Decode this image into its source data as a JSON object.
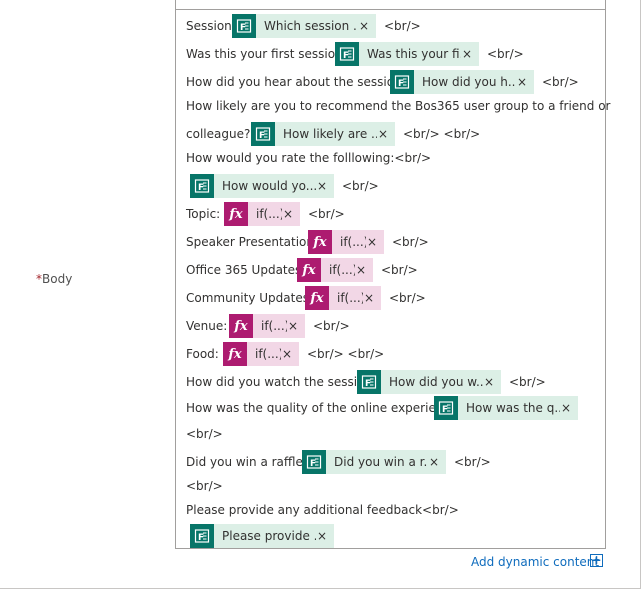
{
  "field": {
    "required_mark": "*",
    "label": "Body"
  },
  "rows": [
    {
      "prefix": "Session:",
      "token": {
        "kind": "forms",
        "label": "Which session ..."
      },
      "suffix": "<br/>"
    },
    {
      "prefix": "Was this your first session?",
      "token": {
        "kind": "forms",
        "label": "Was this your fi..."
      },
      "suffix": "<br/>"
    },
    {
      "prefix": "How did you hear about the session?",
      "token": {
        "kind": "forms",
        "label": "How did you h..."
      },
      "suffix": "<br/>"
    },
    {
      "text": "How likely are you to recommend the Bos365 user group to a friend or"
    },
    {
      "prefix": "colleague?",
      "token": {
        "kind": "forms",
        "label": "How likely are ..."
      },
      "suffix": "<br/> <br/>"
    },
    {
      "text": "How would you rate the folllowing:<br/>"
    },
    {
      "prefix": "",
      "token": {
        "kind": "forms",
        "label": "How would yo..."
      },
      "suffix": "<br/>"
    },
    {
      "prefix": "Topic:",
      "token": {
        "kind": "expression",
        "label": "if(...)"
      },
      "suffix": "<br/>"
    },
    {
      "prefix": "Speaker Presentation:",
      "token": {
        "kind": "expression",
        "label": "if(...)"
      },
      "suffix": "<br/>"
    },
    {
      "prefix": "Office 365 Updates:",
      "token": {
        "kind": "expression",
        "label": "if(...)"
      },
      "suffix": "<br/>"
    },
    {
      "prefix": "Community Updates:",
      "token": {
        "kind": "expression",
        "label": "if(...)"
      },
      "suffix": "<br/>"
    },
    {
      "prefix": "Venue:",
      "token": {
        "kind": "expression",
        "label": "if(...)"
      },
      "suffix": "<br/>"
    },
    {
      "prefix": "Food:",
      "token": {
        "kind": "expression",
        "label": "if(...)"
      },
      "suffix": "<br/> <br/>"
    },
    {
      "prefix": "How did you watch the session:",
      "token": {
        "kind": "forms",
        "label": "How did you w..."
      },
      "suffix": "<br/>"
    },
    {
      "prefix": "How was the quality of the online experience:",
      "token": {
        "kind": "forms",
        "label": "How was the q..."
      },
      "suffix": ""
    },
    {
      "text": "<br/>"
    },
    {
      "prefix": "Did you win a raffle?",
      "token": {
        "kind": "forms",
        "label": "Did you win a r..."
      },
      "suffix": "<br/>"
    },
    {
      "text": "<br/>"
    },
    {
      "text": "Please provide any additional feedback<br/>"
    },
    {
      "prefix": "",
      "token": {
        "kind": "forms",
        "label": "Please provide ..."
      },
      "suffix": ""
    }
  ],
  "add_dynamic_content": {
    "label": "Add dynamic content",
    "icon": "plus-box-icon"
  },
  "icons": {
    "forms": "forms-icon",
    "expression": "fx-icon",
    "remove": "remove-icon"
  },
  "colors": {
    "forms_bg": "#dcefe6",
    "forms_icon": "#077568",
    "expr_bg": "#f2d7e6",
    "expr_icon": "#ad1b70",
    "link": "#0f6cbd",
    "required": "#a4262c"
  }
}
